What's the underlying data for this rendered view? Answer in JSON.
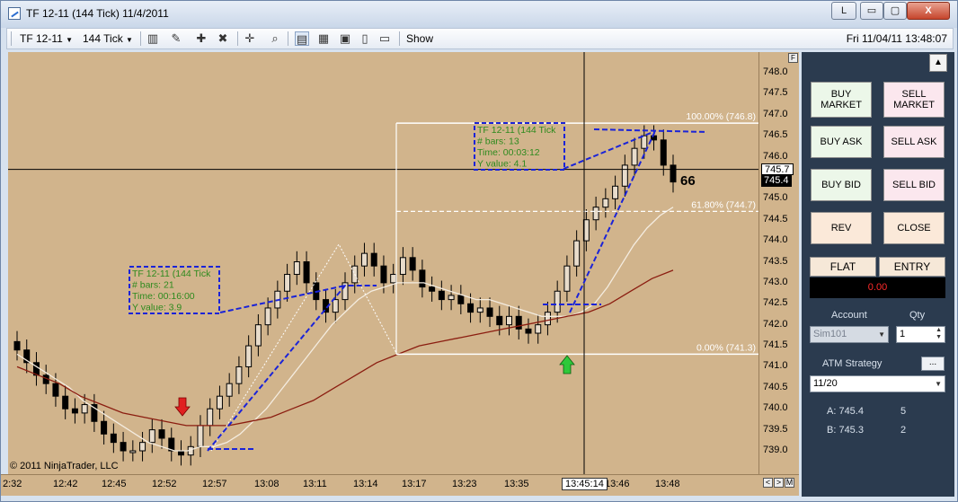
{
  "window": {
    "title": "TF 12-11 (144 Tick)  11/4/2011",
    "link_button": "L",
    "min": "▭",
    "max": "▢",
    "close": "X"
  },
  "toolbar": {
    "instrument": "TF 12-11",
    "period": "144 Tick",
    "show": "Show",
    "datetime": "Fri 11/04/11 13:48:07"
  },
  "chart": {
    "copyright": "© 2011 NinjaTrader, LLC",
    "y_ticks": [
      "748.0",
      "747.5",
      "747.0",
      "746.5",
      "746.0",
      "745.5",
      "745.0",
      "744.5",
      "744.0",
      "743.5",
      "743.0",
      "742.5",
      "742.0",
      "741.5",
      "741.0",
      "740.5",
      "740.0",
      "739.5",
      "739.0"
    ],
    "x_ticks": [
      "2:32",
      "12:42",
      "12:45",
      "12:52",
      "12:57",
      "13:08",
      "13:11",
      "13:14",
      "13:17",
      "13:23",
      "13:35",
      "13:46",
      "13:48"
    ],
    "price_tag_crosshair": "745.7",
    "price_tag_last": "745.4",
    "time_tag": "13:45:14",
    "bar_counter": "66",
    "fib": {
      "top": "100.00% (746.8)",
      "mid": "61.80% (744.7)",
      "bottom": "0.00% (741.3)"
    },
    "ruler1": {
      "title": "TF 12-11 (144 Tick",
      "bars": "# bars:   21",
      "time": "Time:     00:16:00",
      "yvalue": "Y value: 3.9"
    },
    "ruler2": {
      "title": "TF 12-11 (144 Tick",
      "bars": "# bars:   13",
      "time": "Time:     00:03:12",
      "yvalue": "Y value: 4.1"
    },
    "f_label": "F",
    "nav": [
      "<",
      ">",
      "M"
    ]
  },
  "chart_data": {
    "type": "candlestick",
    "ylim": [
      738.5,
      748.3
    ],
    "x_ticks": [
      "2:32",
      "12:42",
      "12:45",
      "12:52",
      "12:57",
      "13:08",
      "13:11",
      "13:14",
      "13:17",
      "13:23",
      "13:35",
      "13:46",
      "13:48"
    ],
    "y_ticks": [
      748.0,
      747.5,
      747.0,
      746.5,
      746.0,
      745.5,
      745.0,
      744.5,
      744.0,
      743.5,
      743.0,
      742.5,
      742.0,
      741.5,
      741.0,
      740.5,
      740.0,
      739.5,
      739.0
    ],
    "close_series": [
      741.4,
      741.1,
      740.8,
      740.6,
      740.3,
      740.0,
      739.9,
      740.1,
      739.7,
      739.4,
      739.2,
      739.0,
      739.0,
      739.2,
      739.5,
      739.3,
      739.0,
      738.9,
      739.1,
      739.6,
      740.0,
      740.3,
      740.6,
      741.0,
      741.5,
      742.0,
      742.4,
      742.8,
      743.2,
      743.5,
      743.0,
      742.6,
      742.3,
      742.6,
      743.0,
      743.4,
      743.7,
      743.4,
      743.0,
      743.2,
      743.6,
      743.3,
      742.9,
      742.8,
      742.6,
      742.7,
      742.5,
      742.3,
      742.4,
      742.2,
      742.0,
      742.2,
      741.9,
      741.8,
      742.0,
      742.3,
      742.8,
      743.4,
      744.0,
      744.5,
      744.8,
      745.0,
      745.3,
      745.8,
      746.2,
      746.5,
      746.4,
      745.8,
      745.4
    ],
    "sma_fast": [
      741.3,
      741.1,
      740.9,
      740.7,
      740.5,
      740.2,
      740.0,
      739.8,
      739.6,
      739.4,
      739.2,
      739.1,
      739.0,
      739.0,
      739.1,
      739.1,
      739.2,
      739.4,
      739.7,
      740.0,
      740.4,
      740.8,
      741.2,
      741.6,
      742.0,
      742.3,
      742.6,
      742.8,
      742.9,
      743.0,
      743.0,
      743.0,
      742.9,
      742.8,
      742.7,
      742.6,
      742.6,
      742.5,
      742.4,
      742.3,
      742.2,
      742.2,
      742.2,
      742.3,
      742.5,
      742.9,
      743.4,
      743.9,
      744.3,
      744.6,
      744.8
    ],
    "sma_slow": [
      741.0,
      740.8,
      740.6,
      740.3,
      740.1,
      739.9,
      739.8,
      739.7,
      739.6,
      739.6,
      739.6,
      739.7,
      739.8,
      740.0,
      740.2,
      740.5,
      740.8,
      741.1,
      741.3,
      741.5,
      741.6,
      741.7,
      741.8,
      741.9,
      742.0,
      742.1,
      742.2,
      742.3,
      742.5,
      742.8,
      743.1,
      743.3
    ],
    "lines": [
      {
        "name": "crosshair_price",
        "y": 745.7
      },
      {
        "name": "fib_100",
        "y": 746.8
      },
      {
        "name": "fib_61.8",
        "y": 744.7
      },
      {
        "name": "fib_0",
        "y": 741.3
      }
    ]
  },
  "side": {
    "buy_market": "BUY MARKET",
    "sell_market": "SELL MARKET",
    "buy_ask": "BUY ASK",
    "sell_ask": "SELL ASK",
    "buy_bid": "BUY BID",
    "sell_bid": "SELL BID",
    "rev": "REV",
    "close": "CLOSE",
    "flat": "FLAT",
    "entry": "ENTRY",
    "pnl": "0.00",
    "account_label": "Account",
    "qty_label": "Qty",
    "account": "Sim101",
    "qty": "1",
    "atm_label": "ATM Strategy",
    "atm_btn": "...",
    "atm_value": "11/20",
    "ask_label": "A: 745.4",
    "ask_size": "5",
    "bid_label": "B: 745.3",
    "bid_size": "2"
  }
}
